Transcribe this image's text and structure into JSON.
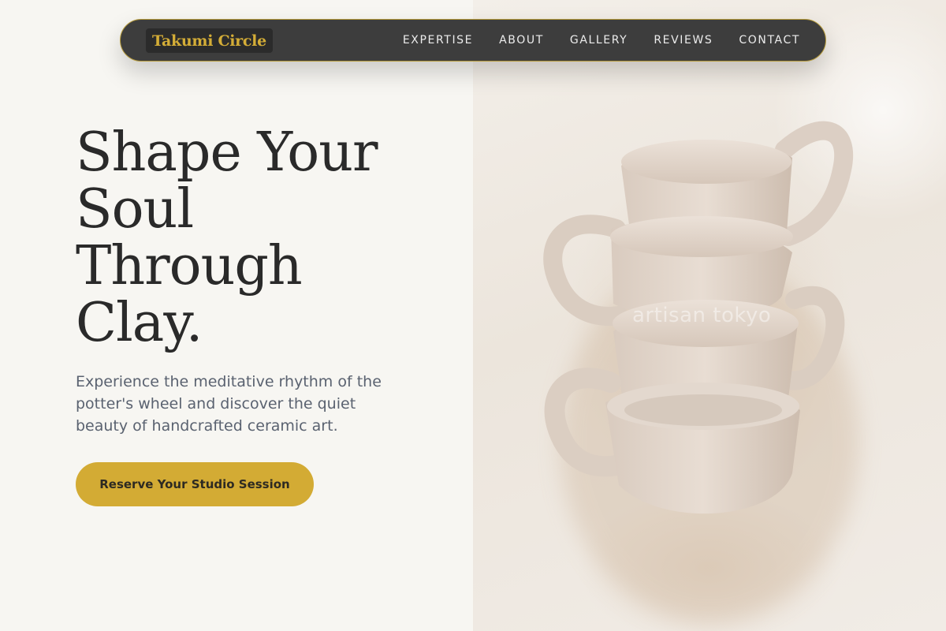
{
  "nav": {
    "brand": "Takumi Circle",
    "links": [
      {
        "label": "EXPERTISE"
      },
      {
        "label": "ABOUT"
      },
      {
        "label": "GALLERY"
      },
      {
        "label": "REVIEWS"
      },
      {
        "label": "CONTACT"
      }
    ]
  },
  "hero": {
    "title_lines": [
      "Shape Your",
      "Soul",
      "Through",
      "Clay."
    ],
    "subtitle": "Experience the meditative rhythm of the potter's wheel and discover the quiet beauty of handcrafted ceramic art.",
    "cta_label": "Reserve Your Studio Session"
  },
  "image": {
    "watermark": "artisan tokyo"
  },
  "colors": {
    "background": "#f7f6f2",
    "nav_bg": "#3d3d3d",
    "nav_border": "#b59a3a",
    "accent_gold": "#d3ab34",
    "heading": "#2a2a2a",
    "body_text": "#5a6270"
  }
}
